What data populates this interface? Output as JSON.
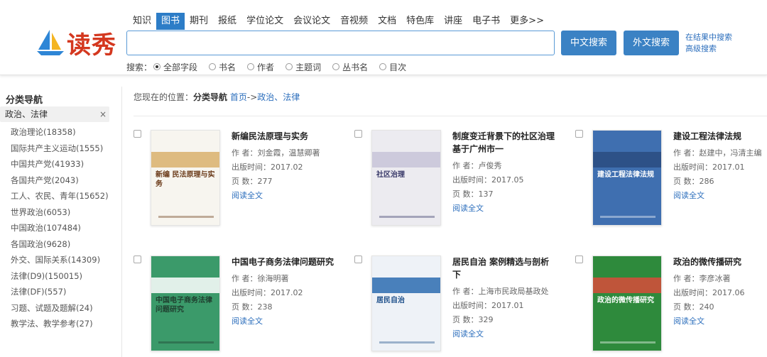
{
  "logo": {
    "text": "读秀"
  },
  "nav": {
    "items": [
      "知识",
      "图书",
      "期刊",
      "报纸",
      "学位论文",
      "会议论文",
      "音视频",
      "文档",
      "特色库",
      "讲座",
      "电子书",
      "更多>>"
    ],
    "active_index": 1
  },
  "search": {
    "value": "",
    "cn_button": "中文搜索",
    "en_button": "外文搜索",
    "in_results": "在结果中搜索",
    "advanced": "高级搜索",
    "field_label": "搜索：",
    "fields": [
      "全部字段",
      "书名",
      "作者",
      "主题词",
      "丛书名",
      "目次"
    ],
    "selected_field": 0
  },
  "sidebar": {
    "title": "分类导航",
    "current": "政治、法律",
    "close_symbol": "×",
    "items": [
      "政治理论(18358)",
      "国际共产主义运动(1555)",
      "中国共产党(41933)",
      "各国共产党(2043)",
      "工人、农民、青年(15652)",
      "世界政治(6053)",
      "中国政治(107484)",
      "各国政治(9628)",
      "外交、国际关系(14309)",
      "法律(D9)(150015)",
      "法律(DF)(557)",
      "习题、试题及题解(24)",
      "教学法、教学参考(27)"
    ]
  },
  "breadcrumb": {
    "prefix": "您现在的位置：",
    "section": "分类导航",
    "home": "首页",
    "sep": "->",
    "current": "政治、法律"
  },
  "books": [
    {
      "title": "新编民法原理与实务",
      "author": "作 者：刘金霞，温慧卿著",
      "date": "出版时间：2017.02",
      "pages": "页 数：277",
      "read": "阅读全文",
      "cover_text": "新编 民法原理与实务"
    },
    {
      "title": "制度变迁背景下的社区治理 基于广州市一",
      "author": "作 者：卢俊秀",
      "date": "出版时间：2017.05",
      "pages": "页 数：137",
      "read": "阅读全文",
      "cover_text": "社区治理"
    },
    {
      "title": "建设工程法律法规",
      "author": "作 者：赵建中，冯清主编",
      "date": "出版时间：2017.01",
      "pages": "页 数：286",
      "read": "阅读全文",
      "cover_text": "建设工程法律法规"
    },
    {
      "title": "中国电子商务法律问题研究",
      "author": "作 者：徐海明著",
      "date": "出版时间：2017.02",
      "pages": "页 数：238",
      "read": "阅读全文",
      "cover_text": "中国电子商务法律问题研究"
    },
    {
      "title": "居民自治 案例精选与剖析 下",
      "author": "作 者：上海市民政局基政处",
      "date": "出版时间：2017.01",
      "pages": "页 数：329",
      "read": "阅读全文",
      "cover_text": "居民自治"
    },
    {
      "title": "政治的微传播研究",
      "author": "作 者：李彦冰著",
      "date": "出版时间：2017.06",
      "pages": "页 数：240",
      "read": "阅读全文",
      "cover_text": "政治的微传播研究"
    }
  ],
  "colors": {
    "accent": "#2d7dc7",
    "button": "#3b82c4",
    "link": "#2d6fbd",
    "logo": "#d4381f"
  }
}
